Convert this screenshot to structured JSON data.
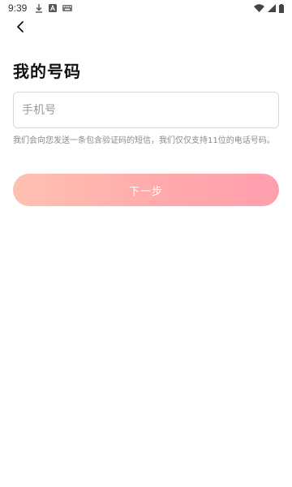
{
  "status_bar": {
    "time": "9:39",
    "left_icons": [
      "download-icon",
      "app-a-icon",
      "keyboard-icon"
    ],
    "right_icons": [
      "wifi-icon",
      "signal-icon",
      "battery-icon"
    ]
  },
  "header": {
    "back_icon": "chevron-left-icon"
  },
  "main": {
    "title": "我的号码",
    "phone_input": {
      "value": "",
      "placeholder": "手机号"
    },
    "hint": "我们会向您发送一条包含验证码的短信，我们仅仅支持11位的电话号码。",
    "next_button_label": "下一步"
  },
  "colors": {
    "button_gradient_start": "#ffc1b0",
    "button_gradient_end": "#ff9fae",
    "input_border": "#d8d8d8",
    "hint_text": "#8a8a8a"
  }
}
